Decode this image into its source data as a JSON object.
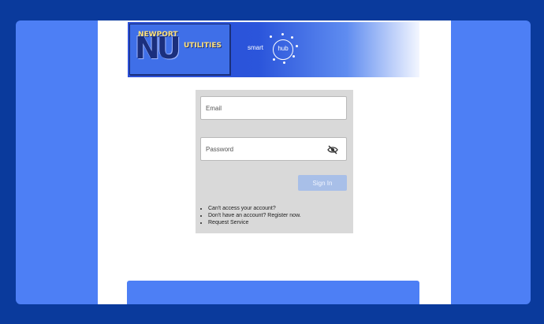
{
  "header": {
    "logo_top": "NEWPORT",
    "logo_monogram": "NU",
    "logo_bottom": "UTILITIES",
    "smart_label": "smart",
    "hub_label": "hub"
  },
  "form": {
    "email_placeholder": "Email",
    "password_placeholder": "Password",
    "eye_icon": "eye-slash-icon",
    "signin_label": "Sign In"
  },
  "links": [
    "Can't access your account?",
    "Don't have an account? Register now.",
    "Request Service"
  ],
  "colors": {
    "outer_background": "#0a3a9c",
    "frame": "#4d7ff5",
    "card": "#d9d9d9",
    "signin_button": "#a8bfe8"
  }
}
